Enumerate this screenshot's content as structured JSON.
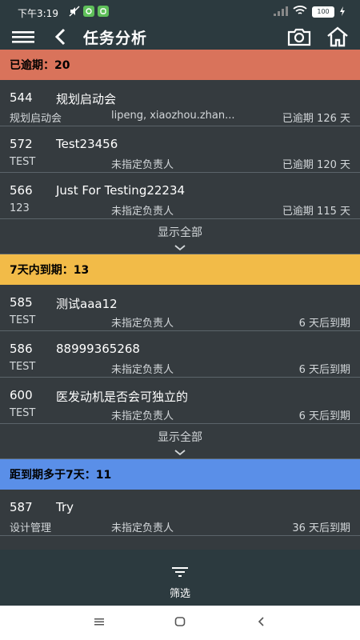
{
  "status_bar": {
    "time": "下午3:19",
    "battery": "100"
  },
  "app_bar": {
    "title": "任务分析",
    "icons": [
      "menu-icon",
      "back-icon",
      "camera-icon",
      "home-icon"
    ]
  },
  "sections": [
    {
      "header": "已逾期：20",
      "color": "#d9735b",
      "items": [
        {
          "id": "544",
          "name": "规划启动会",
          "project": "规划启动会",
          "owner": "lipeng, xiaozhou.zhan...",
          "due": "已逾期 126 天"
        },
        {
          "id": "572",
          "name": "Test23456",
          "project": "TEST",
          "owner": "未指定负责人",
          "due": "已逾期 120 天"
        },
        {
          "id": "566",
          "name": "Just For Testing22234",
          "project": "123",
          "owner": "未指定负责人",
          "due": "已逾期 115 天"
        }
      ],
      "show_all": "显示全部"
    },
    {
      "header": "7天内到期：13",
      "color": "#f2bb48",
      "items": [
        {
          "id": "585",
          "name": "测试aaa12",
          "project": "TEST",
          "owner": "未指定负责人",
          "due": "6 天后到期"
        },
        {
          "id": "586",
          "name": "88999365268",
          "project": "TEST",
          "owner": "未指定负责人",
          "due": "6 天后到期"
        },
        {
          "id": "600",
          "name": "医发动机是否会可独立的",
          "project": "TEST",
          "owner": "未指定负责人",
          "due": "6 天后到期"
        }
      ],
      "show_all": "显示全部"
    },
    {
      "header": "距到期多于7天：11",
      "color": "#5a8fe8",
      "items": [
        {
          "id": "587",
          "name": "Try",
          "project": "设计管理",
          "owner": "未指定负责人",
          "due": "36 天后到期"
        }
      ]
    }
  ],
  "bottom_bar": {
    "filter_label": "筛选"
  }
}
